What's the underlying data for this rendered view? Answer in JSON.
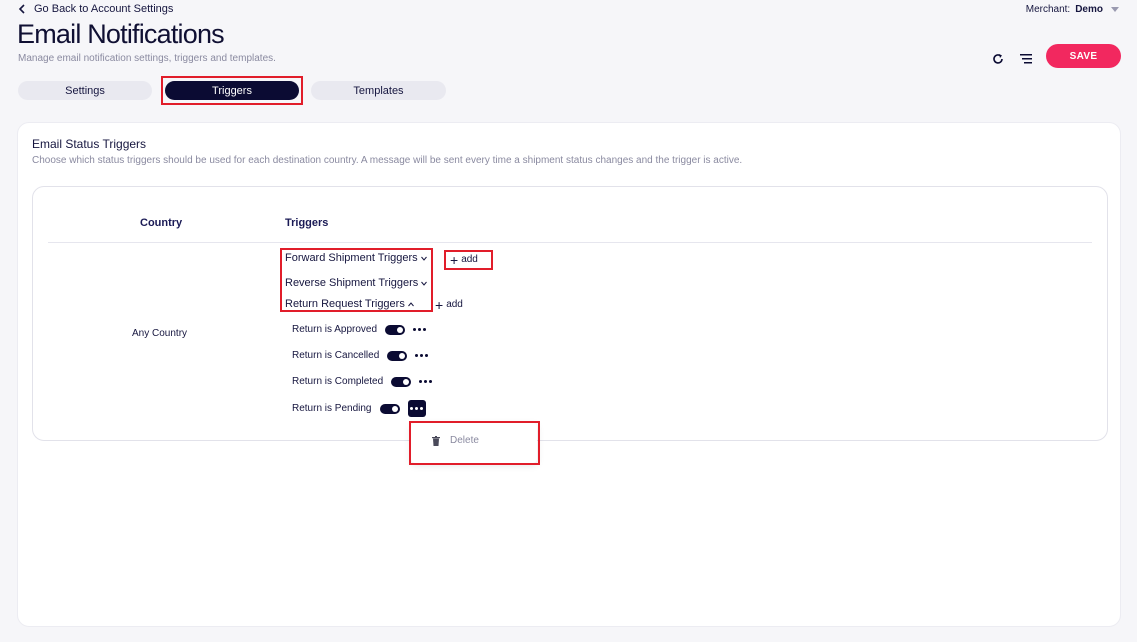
{
  "header": {
    "back_label": "Go Back to Account Settings",
    "merchant_label": "Merchant:",
    "merchant_value": "Demo",
    "title": "Email Notifications",
    "subtitle": "Manage email notification settings, triggers and templates.",
    "save_label": "SAVE"
  },
  "tabs": [
    {
      "label": "Settings",
      "active": false
    },
    {
      "label": "Triggers",
      "active": true
    },
    {
      "label": "Templates",
      "active": false
    }
  ],
  "section": {
    "title": "Email Status Triggers",
    "description": "Choose which status triggers should be used for each destination country. A message will be sent every time a shipment status changes and the trigger is active."
  },
  "table": {
    "columns": [
      "Country",
      "Triggers"
    ],
    "country": "Any Country",
    "groups": [
      {
        "label": "Forward Shipment Triggers",
        "expanded": false
      },
      {
        "label": "Reverse Shipment Triggers",
        "expanded": false
      },
      {
        "label": "Return Request Triggers",
        "expanded": true
      }
    ],
    "add_label": "add",
    "triggers": [
      {
        "label": "Return is Approved",
        "enabled": true
      },
      {
        "label": "Return is Cancelled",
        "enabled": true
      },
      {
        "label": "Return is Completed",
        "enabled": true
      },
      {
        "label": "Return is Pending",
        "enabled": true
      }
    ]
  },
  "menu": {
    "delete_label": "Delete"
  },
  "colors": {
    "primary": "#0b0b33",
    "accent": "#f2285f",
    "highlight": "#e11d2a"
  }
}
